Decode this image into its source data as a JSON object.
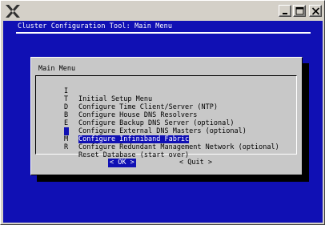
{
  "screen": {
    "title": "Cluster Configuration Tool: Main Menu"
  },
  "dialog": {
    "title": "Main Menu",
    "items": [
      {
        "key": "I",
        "label": "Initial Setup Menu",
        "selected": false
      },
      {
        "key": "T",
        "label": "Configure Time Client/Server (NTP)",
        "selected": false
      },
      {
        "key": "D",
        "label": "Configure House DNS Resolvers",
        "selected": false
      },
      {
        "key": "B",
        "label": "Configure Backup DNS Server (optional)",
        "selected": false
      },
      {
        "key": "E",
        "label": "Configure External DNS Masters (optional)",
        "selected": false
      },
      {
        "key": "F",
        "label": "Configure Infiniband Fabric",
        "selected": true
      },
      {
        "key": "M",
        "label": "Configure Redundant Management Network (optional)",
        "selected": false
      },
      {
        "key": "R",
        "label": "Reset Database (start over)",
        "selected": false
      }
    ],
    "ok_label": "< OK >",
    "quit_label": "< Quit >"
  },
  "icons": {
    "app": "x11-logo-icon",
    "minimize": "minimize-icon",
    "maximize": "maximize-icon",
    "close": "close-icon"
  },
  "colors": {
    "terminal_bg": "#1010b4",
    "dialog_bg": "#c8c8c8",
    "selection_bg": "#1010b4",
    "text_light": "#ffffff"
  }
}
